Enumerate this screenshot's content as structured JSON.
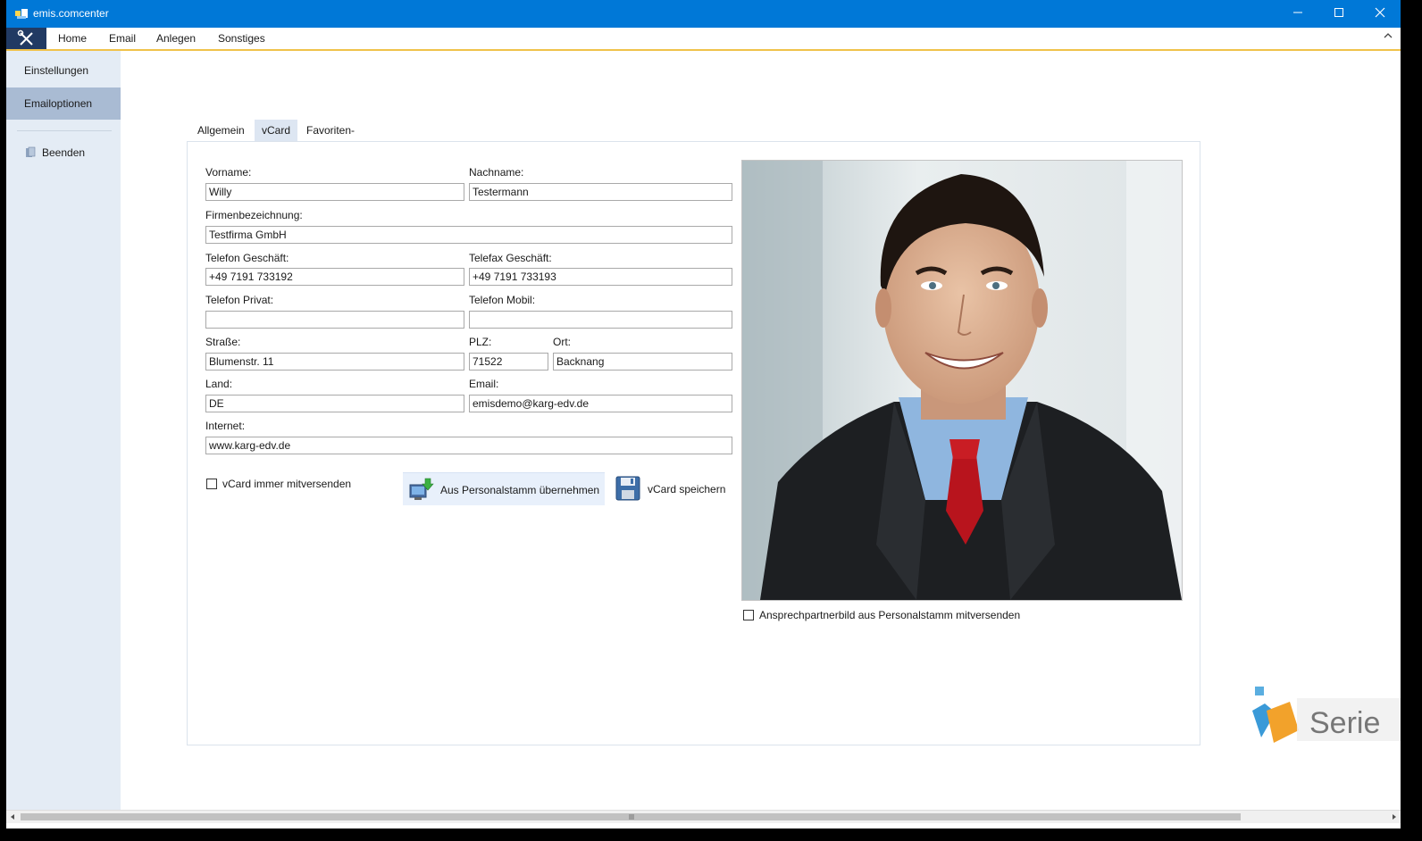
{
  "window": {
    "title": "emis.comcenter"
  },
  "menu": {
    "items": [
      "Home",
      "Email",
      "Anlegen",
      "Sonstiges"
    ]
  },
  "sidebar": {
    "items": [
      "Einstellungen",
      "Emailoptionen"
    ],
    "exit_label": "Beenden",
    "active_index": 1
  },
  "tabs": {
    "items": [
      "Allgemein",
      "vCard",
      "Favoriten-Anhänge"
    ],
    "active_index": 1
  },
  "form": {
    "vorname": {
      "label": "Vorname:",
      "value": "Willy"
    },
    "nachname": {
      "label": "Nachname:",
      "value": "Testermann"
    },
    "firma": {
      "label": "Firmenbezeichnung:",
      "value": "Testfirma GmbH"
    },
    "tel_geschaeft": {
      "label": "Telefon Geschäft:",
      "value": "+49 7191 733192"
    },
    "fax_geschaeft": {
      "label": "Telefax Geschäft:",
      "value": "+49 7191 733193"
    },
    "tel_privat": {
      "label": "Telefon Privat:",
      "value": ""
    },
    "tel_mobil": {
      "label": "Telefon Mobil:",
      "value": ""
    },
    "strasse": {
      "label": "Straße:",
      "value": "Blumenstr. 11"
    },
    "plz": {
      "label": "PLZ:",
      "value": "71522"
    },
    "ort": {
      "label": "Ort:",
      "value": "Backnang"
    },
    "land": {
      "label": "Land:",
      "value": "DE"
    },
    "email": {
      "label": "Email:",
      "value": "emisdemo@karg-edv.de"
    },
    "internet": {
      "label": "Internet:",
      "value": "www.karg-edv.de"
    }
  },
  "actions": {
    "vcard_always_label": "vCard immer mitversenden",
    "vcard_always_checked": false,
    "import_label": "Aus Personalstamm übernehmen",
    "save_label": "vCard speichern"
  },
  "photo": {
    "checkbox_label": "Ansprechpartnerbild aus Personalstamm mitversenden",
    "checkbox_checked": false
  },
  "watermark": {
    "text": "Serie"
  },
  "colors": {
    "titlebar": "#0078d7",
    "sidebar": "#e4ecf5",
    "sidebar_active": "#a9bbd3",
    "menu_accent": "#f0c24a"
  }
}
